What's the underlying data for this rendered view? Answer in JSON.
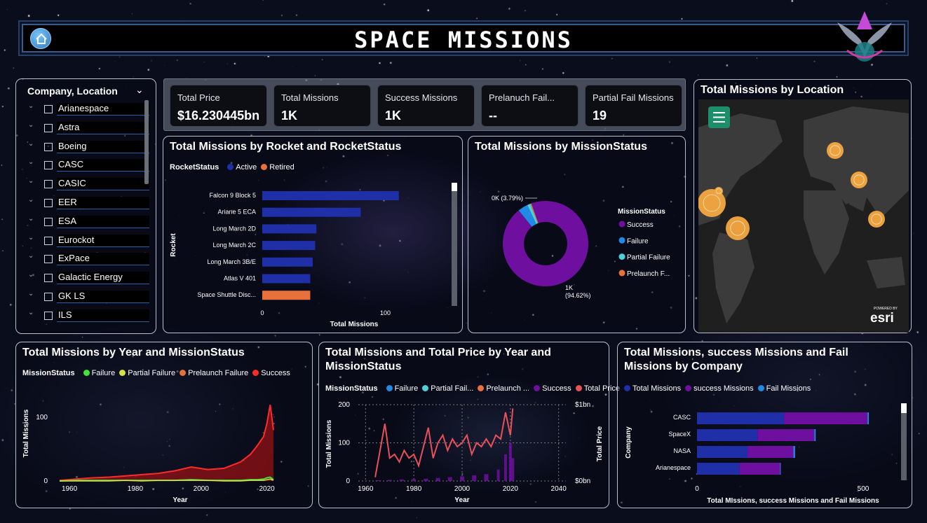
{
  "header": {
    "title": "SPACE MISSIONS"
  },
  "slicer": {
    "title": "Company, Location",
    "items": [
      "Arianespace",
      "Astra",
      "Boeing",
      "CASC",
      "CASIC",
      "EER",
      "ESA",
      "Eurockot",
      "ExPace",
      "Galactic Energy",
      "GK LS",
      "ILS"
    ]
  },
  "cards": [
    {
      "label": "Total Price",
      "value": "$16.230445bn"
    },
    {
      "label": "Total Missions",
      "value": "1K"
    },
    {
      "label": "Success Missions",
      "value": "1K"
    },
    {
      "label": "Prelanuch Fail...",
      "value": "--"
    },
    {
      "label": "Partial Fail Missions",
      "value": "19"
    }
  ],
  "colors": {
    "active": "#1e2fa8",
    "retired": "#e8703a",
    "success": "#6e0fa0",
    "failure": "#1f8be6",
    "partial": "#4fd0d8",
    "prelaunch": "#e8703a",
    "lineFailure": "#41e23c",
    "linePartial": "#d8e04a",
    "lineSuccess": "#ff2a2a",
    "totalPrice": "#e8505a",
    "totalMissions": "#1e2fa8",
    "successMissions": "#6e0fa0",
    "failMissions": "#1f8be6",
    "mapBubble": "#f6a83f"
  },
  "chart_data": [
    {
      "type": "bar",
      "title": "Total Missions by Rocket and RocketStatus",
      "legend_title": "RocketStatus",
      "series": [
        {
          "name": "Active"
        },
        {
          "name": "Retired"
        }
      ],
      "categories": [
        "Falcon 9 Block 5",
        "Ariane 5 ECA",
        "Long March 2D",
        "Long March 2C",
        "Long March 3B/E",
        "Atlas V 401",
        "Space Shuttle Disc..."
      ],
      "values": [
        111,
        80,
        44,
        43,
        41,
        39,
        39
      ],
      "status": [
        "Active",
        "Active",
        "Active",
        "Active",
        "Active",
        "Active",
        "Retired"
      ],
      "xlabel": "Total Missions",
      "ylabel": "Rocket",
      "xticks": [
        "0",
        "100"
      ],
      "xlim": [
        0,
        160
      ]
    },
    {
      "type": "pie",
      "title": "Total Missions by MissionStatus",
      "legend_title": "MissionStatus",
      "slices": [
        {
          "name": "Success",
          "value": 94.62
        },
        {
          "name": "Failure",
          "value": 3.79
        },
        {
          "name": "Partial Failure",
          "value": 1.2
        },
        {
          "name": "Prelaunch F...",
          "value": 0.39
        }
      ],
      "labels": {
        "small": "0K (3.79%)",
        "large_1": "1K",
        "large_2": "(94.62%)"
      }
    },
    {
      "type": "area",
      "title": "Total Missions by Year and MissionStatus",
      "legend_title": "MissionStatus",
      "series_names": [
        "Failure",
        "Partial Failure",
        "Prelaunch Failure",
        "Success"
      ],
      "x": [
        1957,
        1962,
        1967,
        1972,
        1977,
        1982,
        1987,
        1992,
        1997,
        2002,
        2007,
        2012,
        2015,
        2017,
        2019,
        2020,
        2021,
        2022
      ],
      "series": [
        {
          "name": "Success",
          "values": [
            1,
            3,
            5,
            6,
            8,
            10,
            12,
            16,
            22,
            18,
            20,
            30,
            42,
            55,
            70,
            90,
            120,
            80
          ]
        },
        {
          "name": "Failure",
          "values": [
            0,
            1,
            1,
            1,
            1,
            1,
            1,
            1,
            2,
            1,
            1,
            1,
            2,
            2,
            3,
            5,
            6,
            2
          ]
        },
        {
          "name": "Partial Failure",
          "values": [
            0,
            0,
            0,
            0,
            1,
            0,
            1,
            1,
            1,
            1,
            0,
            0,
            1,
            1,
            1,
            2,
            3,
            1
          ]
        }
      ],
      "xlabel": "Year",
      "ylabel": "Total Missions",
      "xticks": [
        "1960",
        "1980",
        "2000",
        "2020"
      ],
      "yticks": [
        "0",
        "100"
      ],
      "xlim": [
        1957,
        2022
      ],
      "ylim": [
        0,
        130
      ]
    },
    {
      "type": "line",
      "title": "Total Missions and Total Price by Year and MissionStatus",
      "legend_title": "MissionStatus",
      "series_names": [
        "Failure",
        "Partial Fail...",
        "Prelaunch ...",
        "Success",
        "Total Price"
      ],
      "price_x": [
        1964,
        1966,
        1968,
        1970,
        1972,
        1974,
        1976,
        1978,
        1980,
        1982,
        1984,
        1986,
        1988,
        1990,
        1992,
        1994,
        1996,
        1998,
        2000,
        2002,
        2004,
        2006,
        2008,
        2010,
        2012,
        2014,
        2016,
        2018,
        2020,
        2021
      ],
      "price": [
        0.05,
        0.4,
        0.75,
        0.3,
        0.35,
        0.25,
        0.4,
        0.3,
        0.35,
        0.2,
        0.45,
        0.7,
        0.3,
        0.5,
        0.6,
        0.4,
        0.55,
        0.45,
        0.5,
        0.6,
        0.35,
        0.5,
        0.45,
        0.55,
        0.45,
        0.6,
        0.55,
        0.9,
        0.6,
        0.95
      ],
      "success_x": [
        1965,
        1970,
        1975,
        1980,
        1985,
        1990,
        1995,
        2000,
        2005,
        2010,
        2015,
        2018,
        2020,
        2021
      ],
      "success": [
        2,
        3,
        4,
        5,
        6,
        8,
        10,
        12,
        15,
        18,
        30,
        70,
        100,
        60
      ],
      "xlabel": "Year",
      "ylabel": "Total Missions",
      "y2label": "Total Price",
      "xticks": [
        "1960",
        "1980",
        "2000",
        "2020",
        "2040"
      ],
      "yticks": [
        "0",
        "100",
        "200"
      ],
      "y2ticks": [
        "$0bn",
        "$1bn"
      ],
      "xlim": [
        1957,
        2043
      ],
      "ylim": [
        0,
        200
      ]
    },
    {
      "type": "bar",
      "title": "Total Missions, success Missions and Fail Missions by Company",
      "series": [
        {
          "name": "Total Missions",
          "values": [
            262,
            182,
            152,
            128
          ]
        },
        {
          "name": "success Missions",
          "values": [
            251,
            171,
            138,
            122
          ]
        },
        {
          "name": "Fail Missions",
          "values": [
            4,
            4,
            5,
            2
          ]
        }
      ],
      "categories": [
        "CASC",
        "SpaceX",
        "NASA",
        "Arianespace"
      ],
      "xlabel": "Total MIssions, success Missions and Fail Missions",
      "ylabel": "Company",
      "xticks": [
        "0",
        "500"
      ],
      "xlim": [
        0,
        640
      ]
    }
  ],
  "map": {
    "title": "Total Missions by Location",
    "attribution": "esri",
    "attribution_small": "POWERED BY"
  }
}
